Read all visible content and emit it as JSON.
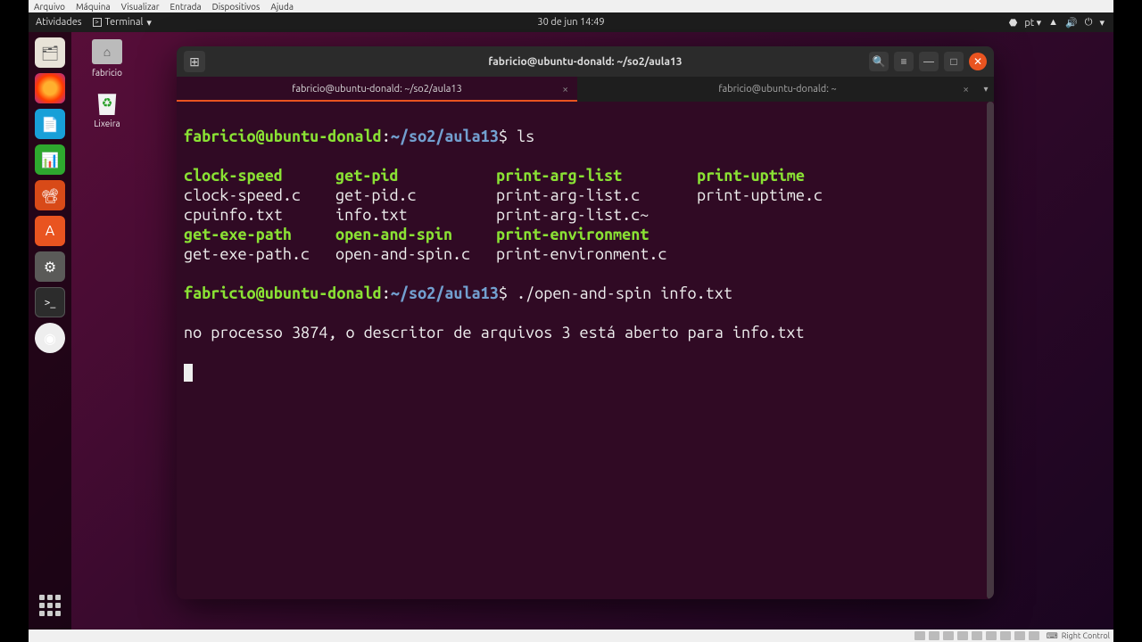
{
  "vbox_menu": [
    "Arquivo",
    "Máquina",
    "Visualizar",
    "Entrada",
    "Dispositivos",
    "Ajuda"
  ],
  "topbar": {
    "activities": "Atividades",
    "appname": "Terminal",
    "datetime": "30 de jun  14:49",
    "lang": "pt"
  },
  "desk": {
    "home": "fabricio",
    "trash": "Lixeira"
  },
  "terminal": {
    "title": "fabricio@ubuntu-donald: ~/so2/aula13",
    "tab1": "fabricio@ubuntu-donald: ~/so2/aula13",
    "tab2": "fabricio@ubuntu-donald: ~",
    "prompt_user": "fabricio@ubuntu-donald",
    "prompt_path": "~/so2/aula13",
    "cmd1": "ls",
    "ls": [
      [
        {
          "t": "clock-speed",
          "c": "exe"
        },
        {
          "t": "get-pid",
          "c": "exe"
        },
        {
          "t": "print-arg-list",
          "c": "exe"
        },
        {
          "t": "print-uptime",
          "c": "exe"
        }
      ],
      [
        {
          "t": "clock-speed.c",
          "c": "reg"
        },
        {
          "t": "get-pid.c",
          "c": "reg"
        },
        {
          "t": "print-arg-list.c",
          "c": "reg"
        },
        {
          "t": "print-uptime.c",
          "c": "reg"
        }
      ],
      [
        {
          "t": "cpuinfo.txt",
          "c": "reg"
        },
        {
          "t": "info.txt",
          "c": "reg"
        },
        {
          "t": "print-arg-list.c~",
          "c": "reg"
        },
        {
          "t": "",
          "c": "reg"
        }
      ],
      [
        {
          "t": "get-exe-path",
          "c": "exe"
        },
        {
          "t": "open-and-spin",
          "c": "exe"
        },
        {
          "t": "print-environment",
          "c": "exe"
        },
        {
          "t": "",
          "c": "reg"
        }
      ],
      [
        {
          "t": "get-exe-path.c",
          "c": "reg"
        },
        {
          "t": "open-and-spin.c",
          "c": "reg"
        },
        {
          "t": "print-environment.c",
          "c": "reg"
        },
        {
          "t": "",
          "c": "reg"
        }
      ]
    ],
    "cmd2": "./open-and-spin info.txt",
    "output": "no processo 3874, o descritor de arquivos 3 está aberto para info.txt"
  },
  "vbox_status": {
    "key": "Right Control"
  }
}
